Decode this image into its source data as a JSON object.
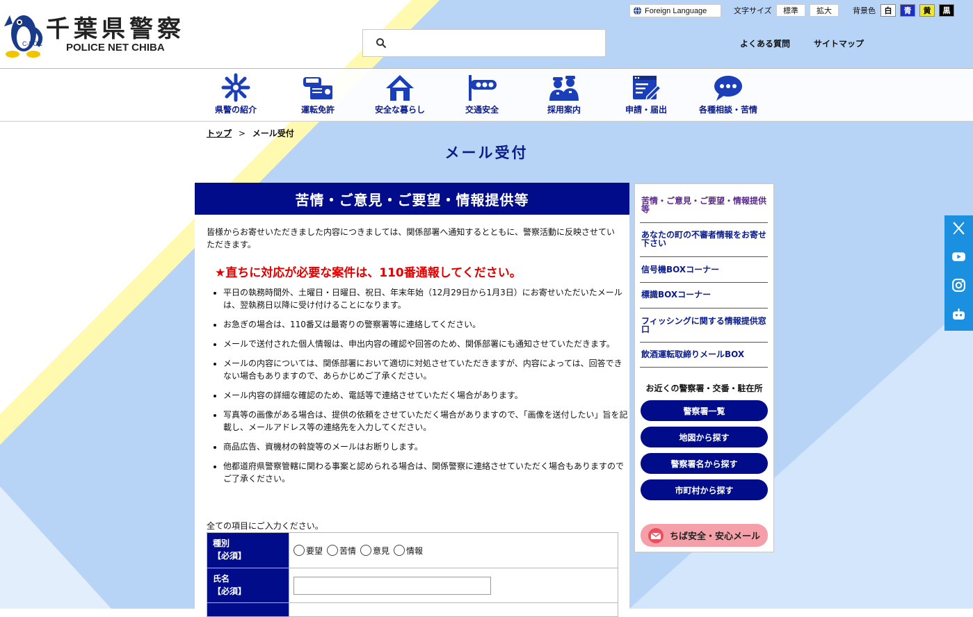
{
  "header": {
    "logo_title": "千葉県警察",
    "logo_sub": "POLICE NET CHIBA",
    "logo_badge": "C-POC",
    "foreign_language": "Foreign Language",
    "font_size_label": "文字サイズ",
    "font_size_options": [
      "標準",
      "拡大"
    ],
    "bg_color_label": "背景色",
    "bg_color_options": [
      "白",
      "青",
      "黄",
      "黒"
    ],
    "links": [
      "よくある質問",
      "サイトマップ"
    ],
    "search_placeholder": ""
  },
  "nav": [
    {
      "label": "県警の紹介",
      "icon": "police-emblem-icon"
    },
    {
      "label": "運転免許",
      "icon": "driver-license-icon"
    },
    {
      "label": "安全な暮らし",
      "icon": "house-icon"
    },
    {
      "label": "交通安全",
      "icon": "traffic-signal-icon"
    },
    {
      "label": "採用案内",
      "icon": "officers-icon"
    },
    {
      "label": "申請・届出",
      "icon": "form-edit-icon"
    },
    {
      "label": "各種相談・苦情",
      "icon": "speech-bubble-icon"
    }
  ],
  "breadcrumb": {
    "home": "トップ",
    "separator": ">",
    "current": "メール受付"
  },
  "page_title": "メール受付",
  "main": {
    "heading": "苦情・ご意見・ご要望・情報提供等",
    "intro": "皆様からお寄せいただきました内容につきましては、関係部署へ通知するとともに、警察活動に反映させていただきます。",
    "urgent": "★直ちに対応が必要な案件は、110番通報してください。",
    "notes": [
      "平日の執務時間外、土曜日・日曜日、祝日、年末年始（12月29日から1月3日）にお寄せいただいたメールは、翌執務日以降に受け付けることになります。",
      "お急ぎの場合は、110番又は最寄りの警察署等に連絡してください。",
      "メールで送付された個人情報は、申出内容の確認や回答のため、関係部署にも通知させていただきます。",
      "メールの内容については、関係部署において適切に対処させていただきますが、内容によっては、回答できない場合もありますので、あらかじめご了承ください。",
      "メール内容の詳細な確認のため、電話等で連絡させていただく場合があります。",
      "写真等の画像がある場合は、提供の依頼をさせていただく場合がありますので、「画像を送付したい」旨を記載し、メールアドレス等の連絡先を入力してください。",
      "商品広告、資機材の斡旋等のメールはお断りします。",
      "他都道府県警察管轄に関わる事案と認められる場合は、関係警察に連絡させていただく場合もありますのでご了承ください。"
    ],
    "form_lead": "全ての項目にご入力ください。",
    "form": {
      "type_label": "種別",
      "type_required": "【必須】",
      "type_options": [
        "要望",
        "苦情",
        "意見",
        "情報"
      ],
      "name_label": "氏名",
      "name_required": "【必須】"
    }
  },
  "sidebar": {
    "links": [
      "苦情・ご意見・ご要望・情報提供等",
      "あなたの町の不審者情報をお寄せ下さい",
      "信号機BOXコーナー",
      "標識BOXコーナー",
      "フィッシングに関する情報提供窓口",
      "飲酒運転取締りメールBOX"
    ],
    "station_heading": "お近くの警察署・交番・駐在所",
    "station_buttons": [
      "警察署一覧",
      "地図から探す",
      "警察署名から探す",
      "市町村から探す"
    ],
    "mail_button": "ちば安全・安心メール"
  },
  "social": [
    "x-icon",
    "youtube-icon",
    "instagram-icon",
    "chatbot-icon"
  ],
  "colors": {
    "primary": "#000c8a",
    "accent_red": "#e00000",
    "bg_blue": "#b7d4f7",
    "stripe_yellow": "#fffab0",
    "social_blue": "#1b8fe0",
    "mail_pink": "#f5a0a8"
  }
}
